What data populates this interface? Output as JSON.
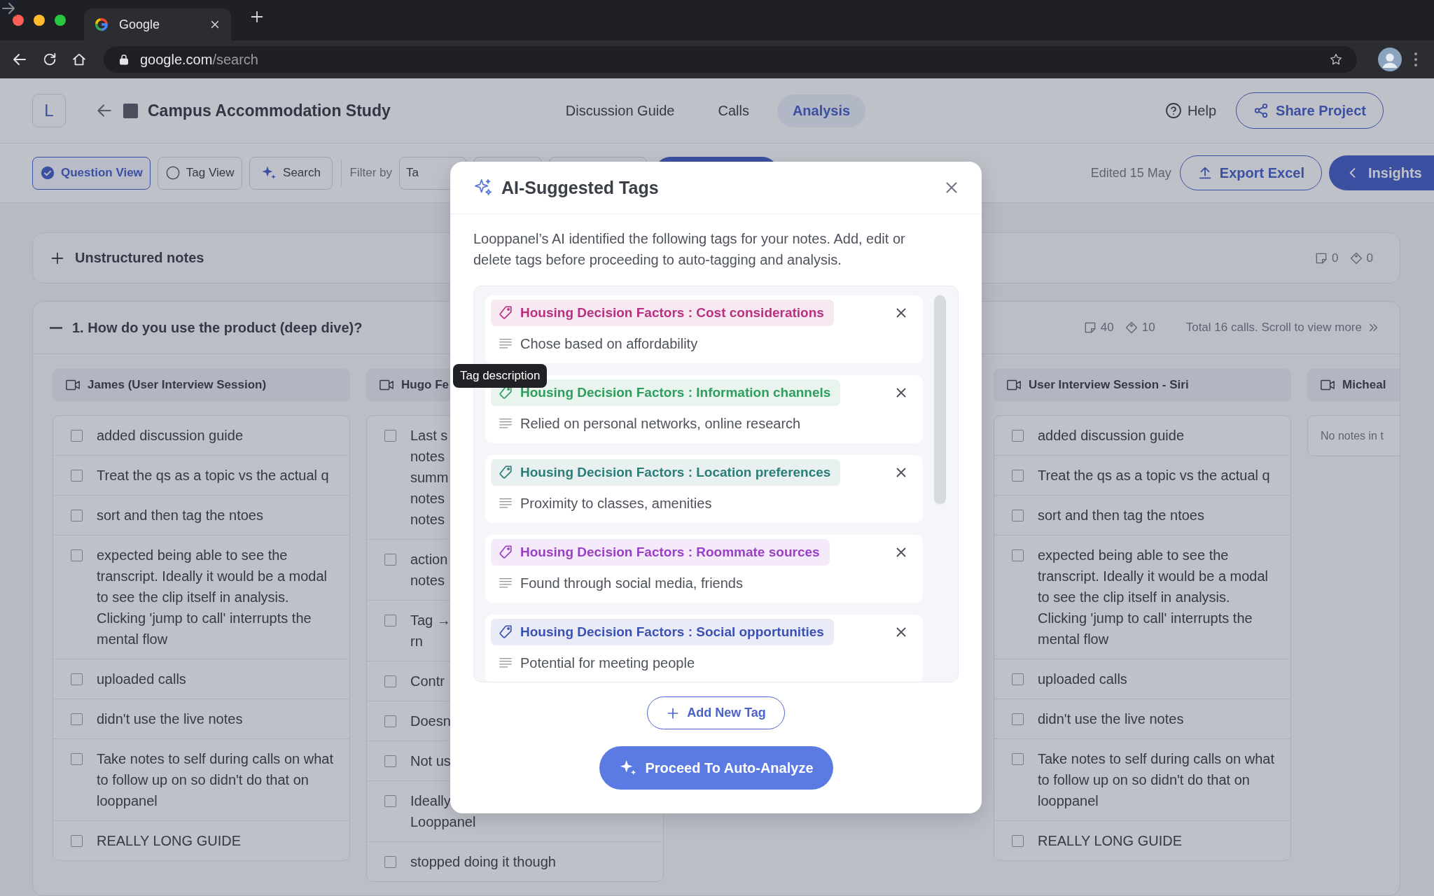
{
  "browser": {
    "tab_title": "Google",
    "url_domain": "google.com",
    "url_path": "/search"
  },
  "header": {
    "logo": "L",
    "title": "Campus Accommodation Study",
    "nav": [
      {
        "label": "Discussion Guide",
        "selected": false
      },
      {
        "label": "Calls",
        "selected": false
      },
      {
        "label": "Analysis",
        "selected": true
      }
    ],
    "help": "Help",
    "share": "Share Project"
  },
  "toolbar": {
    "views": [
      {
        "label": "Question View",
        "selected": true
      },
      {
        "label": "Tag View",
        "selected": false
      }
    ],
    "search": "Search",
    "filter_label": "Filter by",
    "filters": [
      {
        "kind": "text",
        "label": "Ta"
      },
      {
        "kind": "blank"
      },
      {
        "kind": "blank"
      },
      {
        "kind": "primary"
      }
    ],
    "edited": "Edited 15 May",
    "export": "Export Excel",
    "insights": "Insights"
  },
  "unstructured": {
    "title": "Unstructured notes",
    "expanded": false,
    "notes_count": "0",
    "tags_count": "0"
  },
  "question": {
    "title": "1. How do you use the product (deep dive)?",
    "expanded": true,
    "notes_count": "40",
    "tags_count": "10",
    "total": "Total 16 calls. Scroll to view more"
  },
  "calls": [
    {
      "name": "James (User Interview Session)",
      "notes": [
        {
          "text": "added discussion guide",
          "checked": false
        },
        {
          "text": "Treat the qs as a topic vs the actual q",
          "checked": false
        },
        {
          "text": "sort and then tag the ntoes",
          "checked": false
        },
        {
          "text": "expected being able to see the transcript. Ideally it would be a modal to see the clip itself in analysis. Clicking 'jump to call' interrupts the mental flow",
          "checked": false
        },
        {
          "text": "uploaded calls",
          "checked": false
        },
        {
          "text": "didn't use the live notes",
          "checked": false
        },
        {
          "text": "Take notes to self during calls on what to follow up on so didn't do that on looppanel",
          "checked": false
        },
        {
          "text": "REALLY LONG GUIDE",
          "checked": false
        }
      ]
    },
    {
      "name": "Hugo Fe",
      "notes": [
        {
          "text": "Last s\nnotes\nsumm\nnotes\nnotes",
          "checked": false
        },
        {
          "text": "action\nnotes",
          "checked": false
        },
        {
          "text": "Tag →\nrn",
          "checked": false
        },
        {
          "text": "Contr",
          "checked": false
        },
        {
          "text": "Doesn",
          "checked": false
        },
        {
          "text": "Not us",
          "checked": false
        },
        {
          "text": "Ideally\nLooppanel",
          "checked": false
        },
        {
          "text": "stopped doing it though",
          "checked": false
        }
      ]
    },
    {
      "name": "User Interview Session - Siri",
      "notes": [
        {
          "text": "added discussion guide",
          "checked": false
        },
        {
          "text": "Treat the qs as a topic vs the actual q",
          "checked": false
        },
        {
          "text": "sort and then tag the ntoes",
          "checked": false
        },
        {
          "text": "expected being able to see the transcript. Ideally it would be a modal to see the clip itself in analysis. Clicking 'jump to call' interrupts the mental flow",
          "checked": false
        },
        {
          "text": "uploaded calls",
          "checked": false
        },
        {
          "text": "didn't use the live notes",
          "checked": false
        },
        {
          "text": "Take notes to self during calls on what to follow up on so didn't do that on looppanel",
          "checked": false
        },
        {
          "text": "REALLY LONG GUIDE",
          "checked": false
        }
      ]
    },
    {
      "name": "Micheal",
      "empty_text": "No notes in t"
    }
  ],
  "modal": {
    "title": "AI-Suggested Tags",
    "description": "Looppanel’s AI identified the following tags for your notes. Add, edit or delete tags before proceeding to auto-tagging and analysis.",
    "tags": [
      {
        "name": "Housing Decision Factors : Cost considerations",
        "description": "Chose based on affordability",
        "color": "#b8307f"
      },
      {
        "name": "Housing Decision Factors : Information channels",
        "description": "Relied on personal networks, online research",
        "color": "#2e9e5e"
      },
      {
        "name": "Housing Decision Factors : Location preferences",
        "description": "Proximity to classes, amenities",
        "color": "#2a7d78"
      },
      {
        "name": "Housing Decision Factors : Roommate sources",
        "description": "Found through social media, friends",
        "color": "#9a3fc6"
      },
      {
        "name": "Housing Decision Factors : Social opportunities",
        "description": "Potential for meeting people",
        "color": "#3b50b5"
      }
    ],
    "add_button": "Add New Tag",
    "proceed_button": "Proceed To Auto-Analyze",
    "tooltip": "Tag description"
  }
}
